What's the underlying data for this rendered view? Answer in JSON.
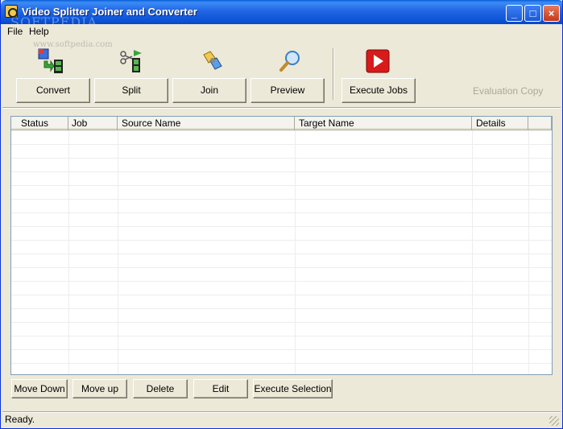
{
  "window": {
    "title": "Video Splitter Joiner and Converter",
    "watermark": "SOFTPEDIA",
    "watermark_small": "www.softpedia.com",
    "controls": {
      "minimize": "_",
      "maximize": "□",
      "close": "×"
    }
  },
  "menu": {
    "file": "File",
    "help": "Help"
  },
  "toolbar": {
    "convert": "Convert",
    "split": "Split",
    "join": "Join",
    "preview": "Preview",
    "execute_jobs": "Execute Jobs",
    "evaluation": "Evaluation Copy",
    "icons": {
      "convert": "convert-icon",
      "split": "split-icon",
      "join": "join-icon",
      "preview": "magnifier-icon",
      "execute": "play-icon"
    }
  },
  "table": {
    "columns": [
      "Status",
      "Job",
      "Source Name",
      "Target Name",
      "Details"
    ],
    "rows": []
  },
  "actions": {
    "move_down": "Move Down",
    "move_up": "Move up",
    "delete": "Delete",
    "edit": "Edit",
    "execute_selection": "Execute Selection"
  },
  "status": {
    "text": "Ready."
  },
  "colors": {
    "title_bar": "#2569e6",
    "face": "#ece9d8",
    "execute_red": "#d81a1a"
  }
}
